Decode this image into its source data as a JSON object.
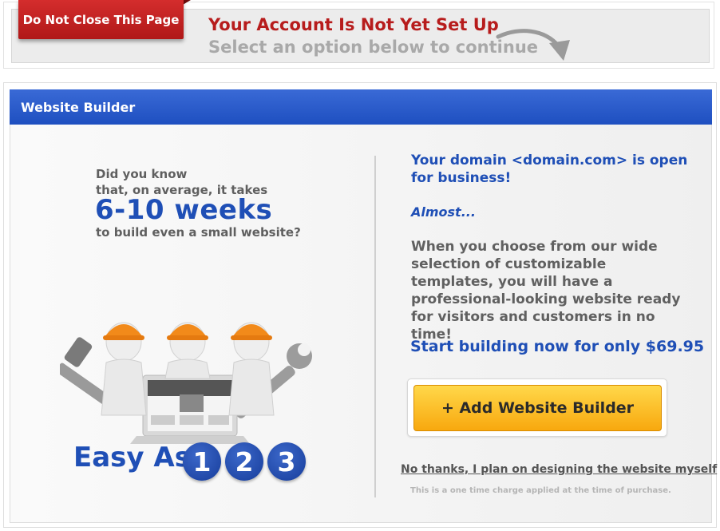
{
  "notice": {
    "tab_label": "Do Not Close This Page",
    "title": "Your Account Is Not Yet Set Up",
    "subtitle": "Select an option below to continue"
  },
  "panel": {
    "header": "Website Builder"
  },
  "left": {
    "line1": "Did you know",
    "line2": "that, on average, it takes",
    "highlight": "6-10 weeks",
    "line4": "to build even a small website?",
    "easy_as": "Easy As",
    "steps": [
      "1",
      "2",
      "3"
    ]
  },
  "right": {
    "domain_message": "Your domain <domain.com> is open for business!",
    "almost": "Almost...",
    "description": "When you choose from our wide selection of customizable templates, you will have a professional-looking website ready for visitors and customers in no time!",
    "price_line": "Start building now for only $69.95",
    "add_button": "+ Add Website Builder",
    "decline_link": "No thanks, I plan on designing the website myself",
    "fine_print": "This is a one time charge applied at the time of purchase."
  },
  "colors": {
    "brand_blue": "#1f4fb6",
    "alert_red": "#b71c1c",
    "button_orange": "#f8a80e"
  }
}
